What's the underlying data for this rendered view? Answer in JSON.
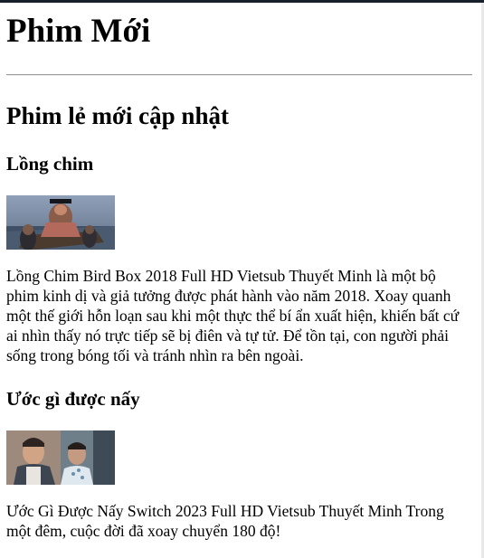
{
  "page": {
    "title": "Phim Mới"
  },
  "section": {
    "heading": "Phim lẻ mới cập nhật"
  },
  "movies": [
    {
      "title": "Lồng chim",
      "description": "Lồng Chim Bird Box 2018 Full HD Vietsub Thuyết Minh là một bộ phim kinh dị và giả tưởng được phát hành vào năm 2018. Xoay quanh một thế giới hỗn loạn sau khi một thực thể bí ẩn xuất hiện, khiến bất cứ ai nhìn thấy nó trực tiếp sẽ bị điên và tự tử. Để tồn tại, con người phải sống trong bóng tối và tránh nhìn ra bên ngoài."
    },
    {
      "title": "Ước gì được nấy",
      "description": "Ước Gì Được Nấy Switch 2023 Full HD Vietsub Thuyết Minh Trong một đêm, cuộc đời đã xoay chuyển 180 độ!"
    }
  ]
}
